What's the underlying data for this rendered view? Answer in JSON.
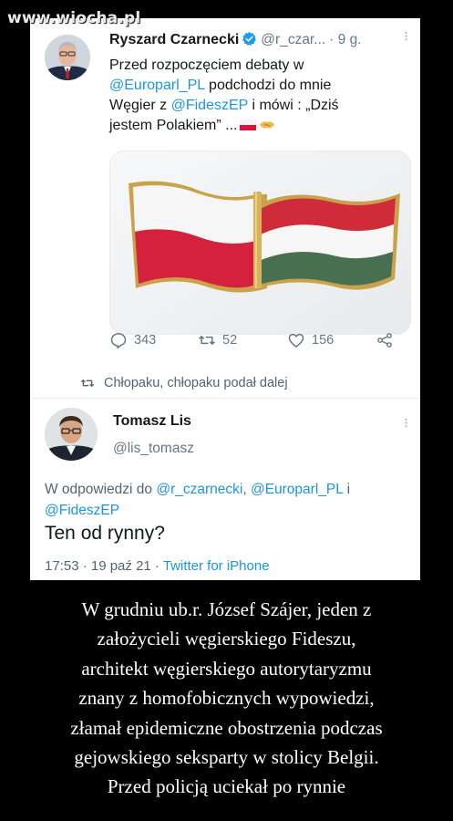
{
  "watermark": "www.wiocha.pl",
  "tweet1": {
    "author_name": "Ryszard Czarnecki",
    "handle": "@r_czar...",
    "time": "· 9 g.",
    "text_line1": "Przed rozpoczęciem debaty w",
    "mention1": "@Europarl_PL",
    "text_line2_tail": " podchodzi do mnie",
    "text_line3_head": "Węgier z ",
    "mention2": "@FideszEP",
    "text_line3_tail": " i mówi : „Dziś",
    "text_line4": "jestem Polakiem” ...",
    "image_subject": "Polish and Hungarian flag pin",
    "replies": "343",
    "retweets": "52",
    "likes": "156"
  },
  "retweet_note": "Chłopaku, chłopaku podał dalej",
  "tweet2": {
    "author_name": "Tomasz Lis",
    "handle": "@lis_tomasz",
    "reply_prefix": "W odpowiedzi do ",
    "reply_mention1": "@r_czarnecki",
    "reply_sep1": ", ",
    "reply_mention2": "@Europarl_PL",
    "reply_sep2": " i",
    "reply_mention3": "@FideszEP",
    "text": "Ten od rynny?",
    "timestamp": "17:53 · 19 paź 21 · ",
    "source": "Twitter for iPhone"
  },
  "caption_lines": [
    "W grudniu ub.r. József Szájer, jeden z",
    "założycieli węgierskiego Fideszu,",
    "architekt węgierskiego autorytaryzmu",
    "znany z homofobicznych wypowiedzi,",
    "złamał epidemiczne obostrzenia podczas",
    "gejowskiego seksparty w stolicy Belgii.",
    "Przed policją uciekał po rynnie"
  ],
  "colors": {
    "twitter_blue": "#1b95e0",
    "verified_blue": "#1d9bf0",
    "polish_red": "#d4213d",
    "hungarian_green": "#477050",
    "gold": "#d8b25a"
  },
  "icons": [
    "verified-badge-icon",
    "reply-icon",
    "retweet-icon",
    "like-icon",
    "share-icon",
    "more-options-icon"
  ]
}
